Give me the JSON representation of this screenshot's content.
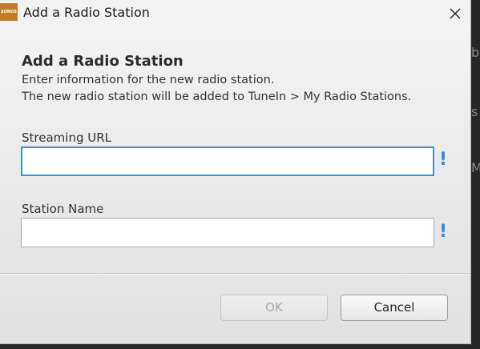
{
  "window": {
    "app_icon_text": "SONOS",
    "title": "Add a Radio Station"
  },
  "dialog": {
    "heading": "Add a Radio Station",
    "description_line1": "Enter information for the new radio station.",
    "description_line2": "The new radio station will be added to TuneIn > My Radio Stations."
  },
  "fields": {
    "streaming_url": {
      "label": "Streaming URL",
      "value": "",
      "required_marker": "!"
    },
    "station_name": {
      "label": "Station Name",
      "value": "",
      "required_marker": "!"
    }
  },
  "buttons": {
    "ok_label": "OK",
    "cancel_label": "Cancel"
  },
  "background_glyphs": [
    "b",
    "s",
    "M"
  ],
  "colors": {
    "app_icon": "#c17d28",
    "focus_border": "#3a8ee6",
    "required_marker": "#2f8be0"
  },
  "icons": {
    "close": "close-icon",
    "app": "sonos-app-icon"
  }
}
